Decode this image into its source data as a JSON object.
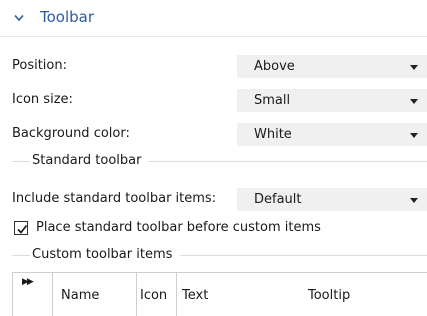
{
  "section": {
    "title": "Toolbar"
  },
  "fields": {
    "position": {
      "label": "Position:",
      "value": "Above"
    },
    "icon_size": {
      "label": "Icon size:",
      "value": "Small"
    },
    "background_color": {
      "label": "Background color:",
      "value": "White"
    }
  },
  "standard_toolbar": {
    "group_title": "Standard toolbar",
    "include_label": "Include standard toolbar items:",
    "include_value": "Default",
    "place_before_label": "Place standard toolbar before custom items",
    "place_before_checked": true
  },
  "custom_toolbar": {
    "group_title": "Custom toolbar items",
    "columns": [
      "Name",
      "Icon",
      "Text",
      "Tooltip"
    ]
  }
}
